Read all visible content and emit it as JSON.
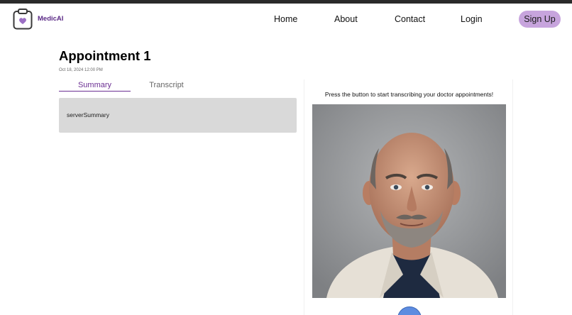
{
  "brand": {
    "name": "MedicAI",
    "logo_icon": "clipboard-heart-icon",
    "accent": "#5b2a86"
  },
  "nav": {
    "links": [
      {
        "label": "Home"
      },
      {
        "label": "About"
      },
      {
        "label": "Contact"
      },
      {
        "label": "Login"
      }
    ],
    "signup_label": "Sign Up",
    "signup_color": "#c7a4dd"
  },
  "appointment": {
    "title": "Appointment 1",
    "date": "Oct 18, 2024 12:00 PM"
  },
  "tabs": [
    {
      "label": "Summary",
      "active": true
    },
    {
      "label": "Transcript",
      "active": false
    }
  ],
  "summary": {
    "text": "serverSummary"
  },
  "recorder": {
    "instruction": "Press the button to start transcribing your doctor appointments!",
    "record_icon": "record-button-icon"
  }
}
